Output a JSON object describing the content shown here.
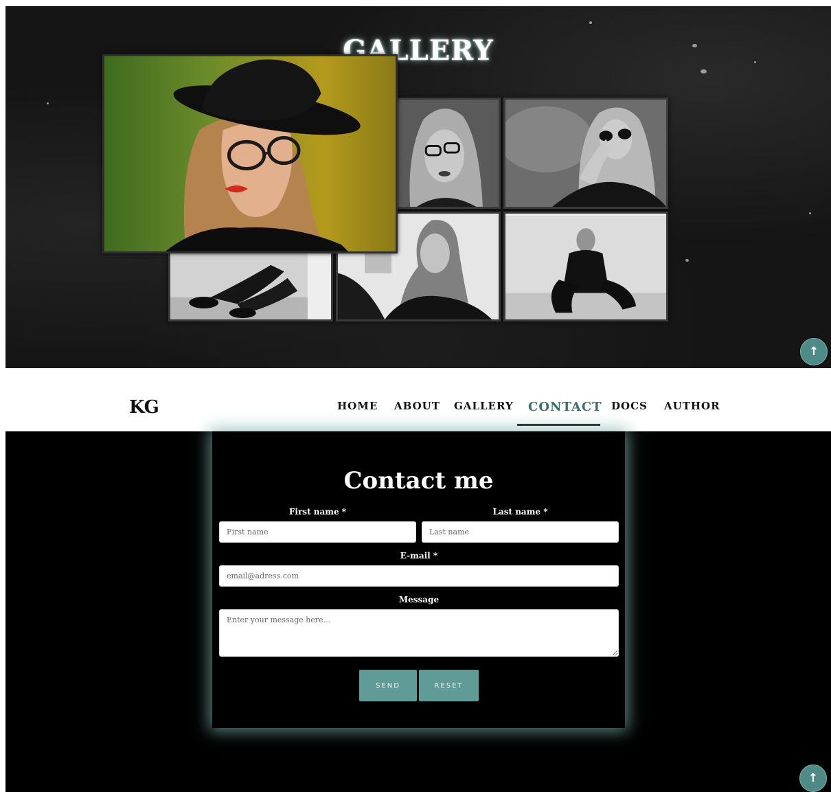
{
  "gallery": {
    "title": "GALLERY",
    "photos": [
      {
        "id": "featured",
        "tone": "color"
      },
      {
        "id": "glasses-closeup",
        "tone": "bw"
      },
      {
        "id": "sunglasses",
        "tone": "bw"
      },
      {
        "id": "hair-hand",
        "tone": "bw"
      },
      {
        "id": "sitting-floor",
        "tone": "bw"
      },
      {
        "id": "legs-floor",
        "tone": "bw"
      }
    ]
  },
  "scroll_top": {
    "icon": "arrow-up-icon",
    "glyph": "↑"
  },
  "nav": {
    "brand": "KG",
    "items": [
      "HOME",
      "ABOUT",
      "GALLERY",
      "CONTACT",
      "DOCS",
      "AUTHOR"
    ],
    "active": "CONTACT"
  },
  "contact": {
    "title": "Contact me",
    "first_name_label": "First name *",
    "first_name_placeholder": "First name",
    "last_name_label": "Last name *",
    "last_name_placeholder": "Last name",
    "email_label": "E-mail *",
    "email_placeholder": "email@adress.com",
    "message_label": "Message",
    "message_placeholder": "Enter your message here...",
    "send_label": "SEND",
    "reset_label": "RESET"
  },
  "colors": {
    "accent": "#5f9c97",
    "glow": "#7eb4af",
    "nav_active": "#3f6f6b"
  }
}
